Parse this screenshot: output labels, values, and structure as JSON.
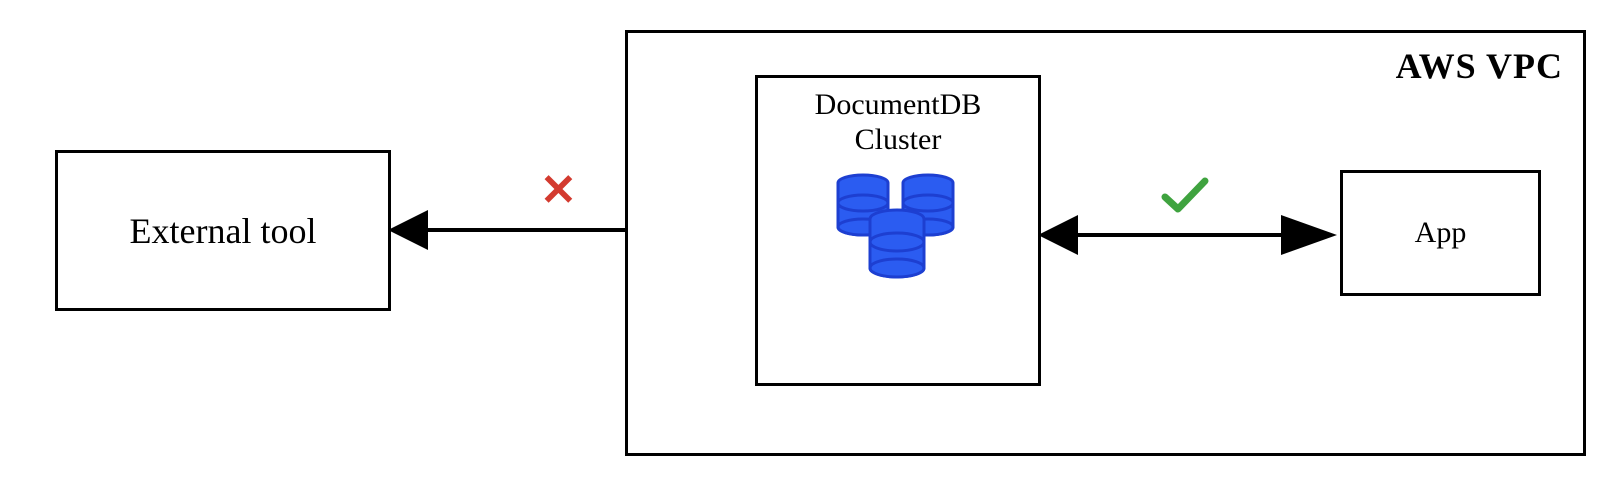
{
  "diagram": {
    "external_tool_label": "External tool",
    "vpc_label": "AWS VPC",
    "cluster_label_line1": "DocumentDB",
    "cluster_label_line2": "Cluster",
    "app_label": "App",
    "connection_blocked_symbol": "✕",
    "connection_allowed_symbol": "✓",
    "colors": {
      "blocked": "#d33a2f",
      "allowed": "#3fa33f",
      "db_stroke": "#1d3fd1",
      "db_fill": "#2b5cf1"
    }
  }
}
